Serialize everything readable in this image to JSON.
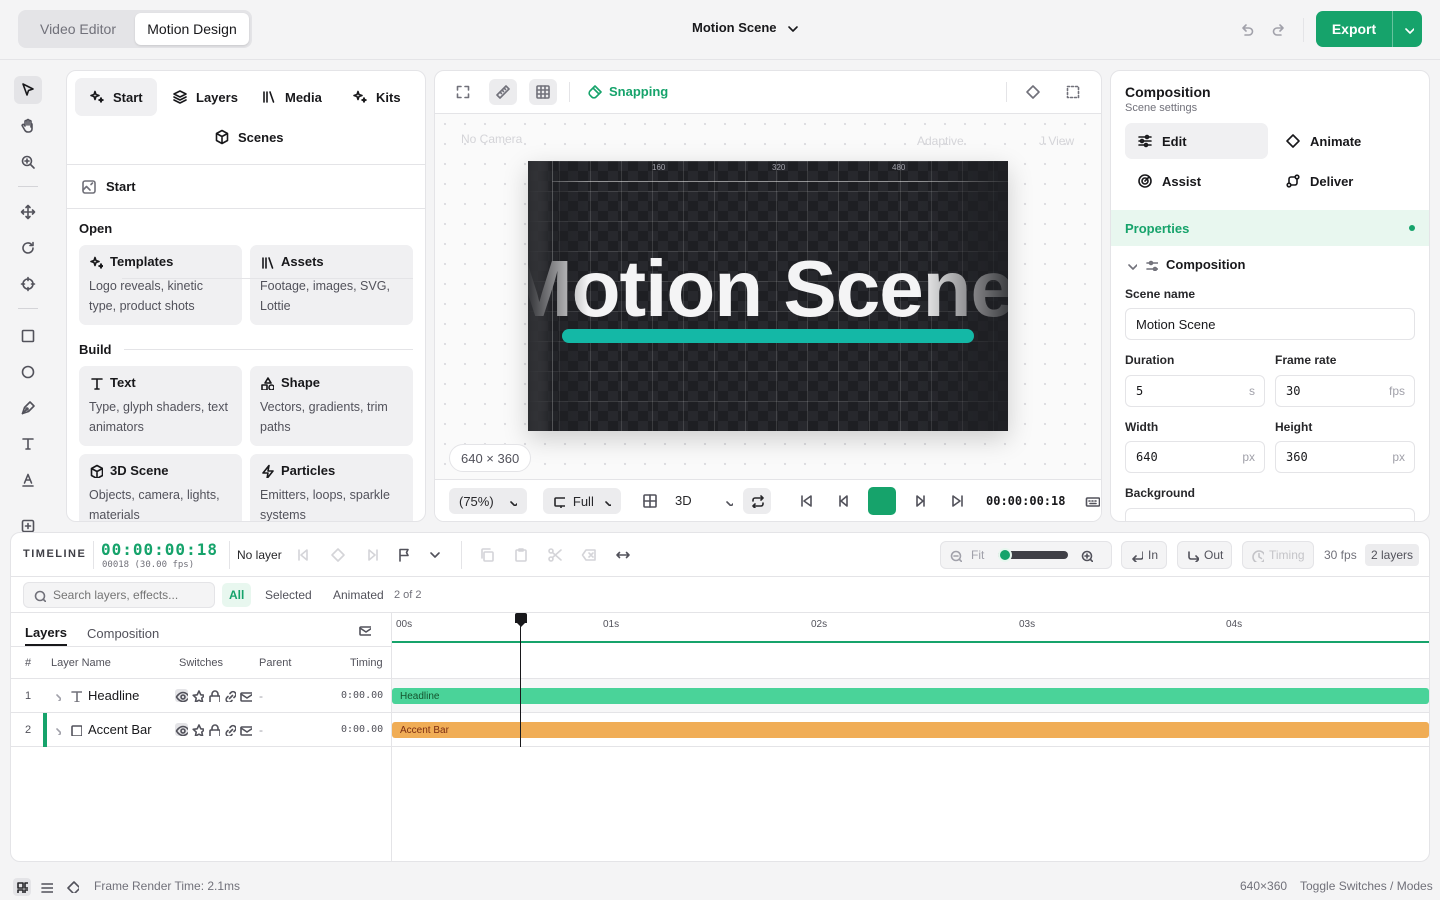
{
  "topbar": {
    "modes": [
      "Video Editor",
      "Motion Design"
    ],
    "scene_title": "Motion Scene",
    "export_label": "Export"
  },
  "left_panel": {
    "tabs": [
      "Start",
      "Layers",
      "Media",
      "Kits",
      "Scenes"
    ],
    "section_title": "Start",
    "open_label": "Open",
    "build_label": "Build",
    "cards": [
      {
        "title": "Templates",
        "desc": "Logo reveals, kinetic type, product shots",
        "icon": "sparkles-icon"
      },
      {
        "title": "Assets",
        "desc": "Footage, images, SVG, Lottie",
        "icon": "library-icon"
      },
      {
        "title": "Text",
        "desc": "Type, glyph shaders, text animators",
        "icon": "text-icon"
      },
      {
        "title": "Shape",
        "desc": "Vectors, gradients, trim paths",
        "icon": "shapes-icon"
      },
      {
        "title": "3D Scene",
        "desc": "Objects, camera, lights, materials",
        "icon": "cube-icon"
      },
      {
        "title": "Particles",
        "desc": "Emitters, loops, sparkle systems",
        "icon": "zap-icon"
      }
    ]
  },
  "viewer": {
    "snapping_label": "Snapping",
    "ghost_labels": [
      "No Camera",
      "Adaptive",
      "J View"
    ],
    "canvas_text": "Motion Scene",
    "ruler_marks": [
      "160",
      "320",
      "480"
    ],
    "size_chip": "640 × 360",
    "zoom": "(75%)",
    "resolution": "Full",
    "mode": "3D",
    "timecode": "00:00:00:18"
  },
  "right_panel": {
    "title": "Composition",
    "subtitle": "Scene settings",
    "tabs": [
      "Edit",
      "Animate",
      "Assist",
      "Deliver"
    ],
    "properties_label": "Properties",
    "group_label": "Composition",
    "scene_name_label": "Scene name",
    "scene_name_value": "Motion Scene",
    "duration_label": "Duration",
    "duration_value": "5",
    "duration_unit": "s",
    "framerate_label": "Frame rate",
    "framerate_value": "30",
    "framerate_unit": "fps",
    "width_label": "Width",
    "width_value": "640",
    "height_label": "Height",
    "height_value": "360",
    "px_unit": "px",
    "background_label": "Background"
  },
  "timeline": {
    "label": "TIMELINE",
    "timecode": "00:00:00:18",
    "frame_info": "00018 (30.00 fps)",
    "layer_select": "No layer",
    "fit_label": "Fit",
    "zoom_level": 0.05,
    "in_label": "In",
    "out_label": "Out",
    "timing_label": "Timing",
    "fps_label": "30 fps",
    "layers_badge": "2 layers",
    "search_placeholder": "Search layers, effects...",
    "filters": [
      "All",
      "Selected",
      "Animated"
    ],
    "count": "2 of 2",
    "tabs": [
      "Layers",
      "Composition"
    ],
    "columns": [
      "#",
      "Layer Name",
      "Switches",
      "Parent",
      "Timing"
    ],
    "rows": [
      {
        "num": "1",
        "name": "Headline",
        "parent": "-",
        "timing": "0:00.00",
        "color": "#4ad399"
      },
      {
        "num": "2",
        "name": "Accent Bar",
        "parent": "-",
        "timing": "0:00.00",
        "color": "#f0ad56"
      }
    ],
    "ruler": [
      "00s",
      "01s",
      "02s",
      "03s",
      "04s"
    ],
    "playhead_seconds": 0.6
  },
  "status": {
    "render_time": "Frame Render Time: 2.1ms",
    "dimensions": "640×360",
    "hint": "Toggle Switches / Modes"
  },
  "colors": {
    "accent": "#16a36b",
    "teal": "#14b8a6"
  }
}
